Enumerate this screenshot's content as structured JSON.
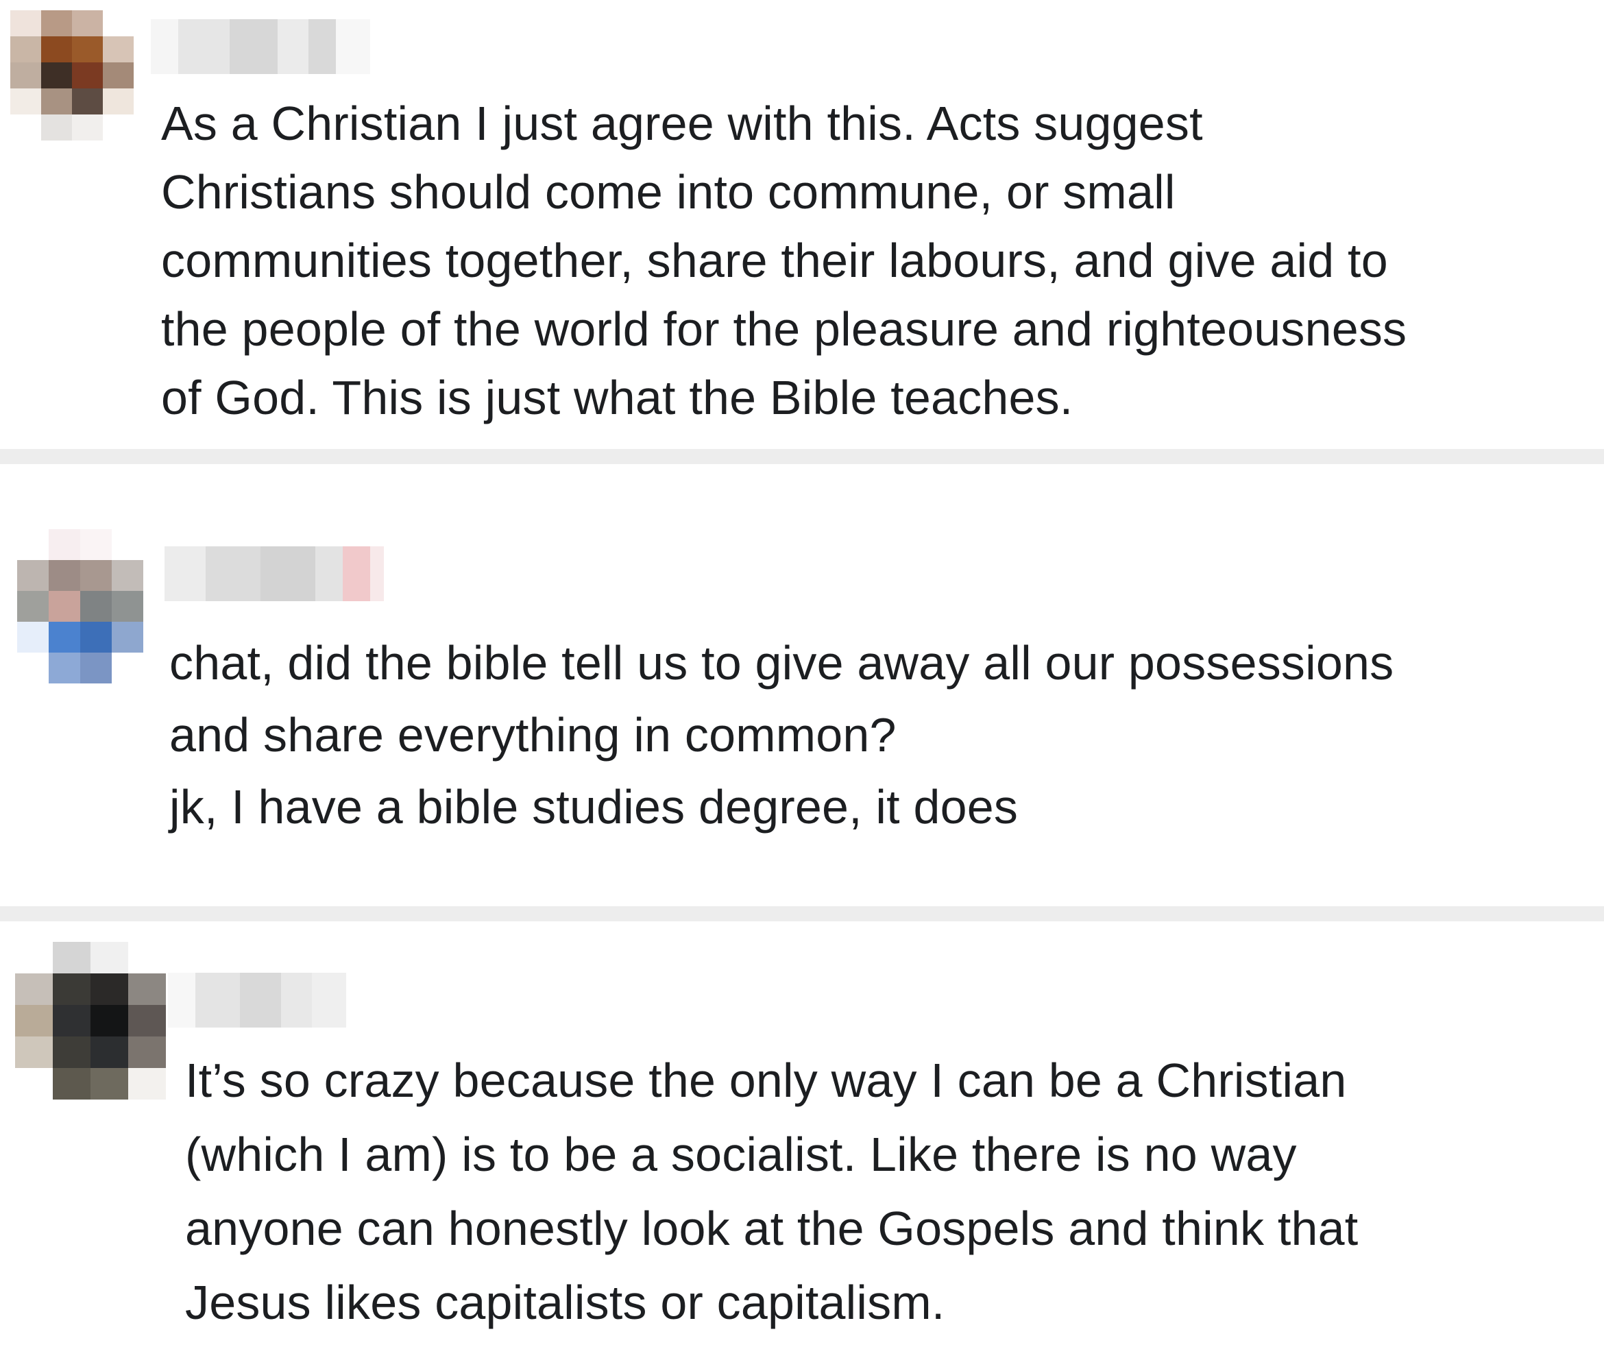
{
  "comments": [
    {
      "author": {
        "avatar_icon": "avatar-pixelated",
        "avatar_colors": [
          [
            "#efe3dc",
            "#b89a86",
            "#cbb3a4",
            "#ffffff"
          ],
          [
            "#c9b6a6",
            "#8c4a20",
            "#9a5a2a",
            "#d7c4b6"
          ],
          [
            "#bfaea0",
            "#3e2f26",
            "#7b3a22",
            "#a48a78"
          ],
          [
            "#f2ece6",
            "#a89282",
            "#5d4c43",
            "#efe6dd"
          ],
          [
            "#ffffff",
            "#e4e2e0",
            "#f1efed",
            "#ffffff"
          ]
        ],
        "name_redacted": true
      },
      "text_lines": [
        "As a Christian I just agree with this. Acts suggest",
        "Christians should come into commune, or small",
        "communities together, share their labours, and give aid to",
        "the people of the world for the pleasure and righteousness",
        "of God. This is just what the Bible teaches."
      ]
    },
    {
      "author": {
        "avatar_icon": "avatar-pixelated",
        "avatar_colors": [
          [
            "#ffffff",
            "#f7eef0",
            "#faf4f5",
            "#ffffff"
          ],
          [
            "#bdb5b0",
            "#9d8c86",
            "#a89890",
            "#c2bcb8"
          ],
          [
            "#9fa09c",
            "#c9a39b",
            "#7f8384",
            "#8f9392"
          ],
          [
            "#e6eefa",
            "#4b82cf",
            "#3d6fb8",
            "#8ea7cf"
          ],
          [
            "#ffffff",
            "#8da9d6",
            "#7b95c4",
            "#ffffff"
          ]
        ],
        "name_redacted": true
      },
      "text_lines": [
        "chat, did the bible tell us to give away all our possessions",
        "and share everything in common?",
        "jk, I have a bible studies degree, it does"
      ]
    },
    {
      "author": {
        "avatar_icon": "avatar-pixelated",
        "avatar_colors": [
          [
            "#ffffff",
            "#d5d5d5",
            "#f0f0f0",
            "#ffffff"
          ],
          [
            "#c6bfb8",
            "#3b3a36",
            "#2b2928",
            "#8c8782"
          ],
          [
            "#b9ab98",
            "#2f3032",
            "#141516",
            "#5e5754"
          ],
          [
            "#cfc7bb",
            "#3e3d38",
            "#2c2e30",
            "#7b746e"
          ],
          [
            "#ffffff",
            "#5d594e",
            "#6e6a5e",
            "#f3f1ee"
          ]
        ],
        "name_redacted": true
      },
      "text_lines": [
        "It’s so crazy because the only way I can be a Christian",
        "(which I am) is to be a socialist. Like there is no way",
        "anyone can honestly look at the Gospels and think that",
        "Jesus likes capitalists or capitalism."
      ]
    }
  ]
}
